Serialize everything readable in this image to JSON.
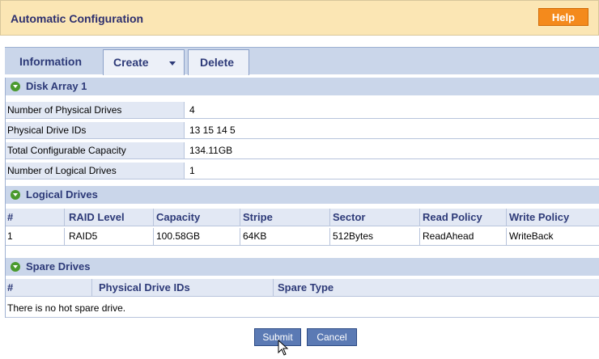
{
  "header": {
    "title": "Automatic Configuration",
    "help_label": "Help"
  },
  "tabs": [
    {
      "label": "Information"
    },
    {
      "label": "Create"
    },
    {
      "label": "Delete"
    }
  ],
  "disk_array": {
    "title": "Disk Array 1",
    "rows": [
      {
        "label": "Number of Physical Drives",
        "value": "4"
      },
      {
        "label": "Physical Drive IDs",
        "value": "13 15 14 5"
      },
      {
        "label": "Total Configurable Capacity",
        "value": "134.11GB"
      },
      {
        "label": "Number of Logical Drives",
        "value": "1"
      }
    ]
  },
  "logical_drives": {
    "title": "Logical Drives",
    "headers": [
      "#",
      "RAID Level",
      "Capacity",
      "Stripe",
      "Sector",
      "Read Policy",
      "Write Policy"
    ],
    "rows": [
      [
        "1",
        "RAID5",
        "100.58GB",
        "64KB",
        "512Bytes",
        "ReadAhead",
        "WriteBack"
      ]
    ]
  },
  "spare_drives": {
    "title": "Spare Drives",
    "headers": [
      "#",
      "Physical Drive IDs",
      "Spare Type"
    ],
    "empty_text": "There is no hot spare drive."
  },
  "buttons": {
    "submit": "Submit",
    "cancel": "Cancel"
  }
}
